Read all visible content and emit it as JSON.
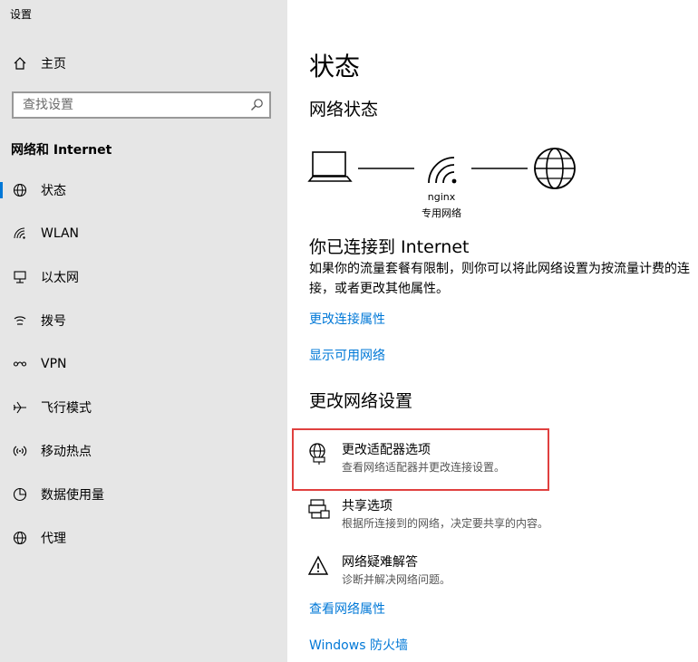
{
  "app": {
    "title": "设置"
  },
  "sidebar": {
    "home_label": "主页",
    "search_placeholder": "查找设置",
    "section_title": "网络和 Internet",
    "items": [
      {
        "label": "状态",
        "icon": "globe-icon",
        "active": true
      },
      {
        "label": "WLAN",
        "icon": "wifi-icon"
      },
      {
        "label": "以太网",
        "icon": "ethernet-icon"
      },
      {
        "label": "拨号",
        "icon": "dialup-icon"
      },
      {
        "label": "VPN",
        "icon": "vpn-icon"
      },
      {
        "label": "飞行模式",
        "icon": "airplane-icon"
      },
      {
        "label": "移动热点",
        "icon": "hotspot-icon"
      },
      {
        "label": "数据使用量",
        "icon": "data-usage-icon"
      },
      {
        "label": "代理",
        "icon": "globe-icon"
      }
    ]
  },
  "main": {
    "title": "状态",
    "network_status_heading": "网络状态",
    "network_name": "nginx",
    "network_type": "专用网络",
    "connected_heading": "你已连接到 Internet",
    "connected_desc": "如果你的流量套餐有限制，则你可以将此网络设置为按流量计费的连接，或者更改其他属性。",
    "link_change_props": "更改连接属性",
    "link_show_networks": "显示可用网络",
    "change_settings_heading": "更改网络设置",
    "options": [
      {
        "title": "更改适配器选项",
        "desc": "查看网络适配器并更改连接设置。",
        "icon": "adapter-icon"
      },
      {
        "title": "共享选项",
        "desc": "根据所连接到的网络，决定要共享的内容。",
        "icon": "sharing-icon"
      },
      {
        "title": "网络疑难解答",
        "desc": "诊断并解决网络问题。",
        "icon": "warning-icon"
      }
    ],
    "link_view_props": "查看网络属性",
    "link_firewall": "Windows 防火墙"
  },
  "colors": {
    "accent": "#0078d7",
    "highlight": "#e0403f",
    "sidebar_bg": "#e6e6e6"
  }
}
